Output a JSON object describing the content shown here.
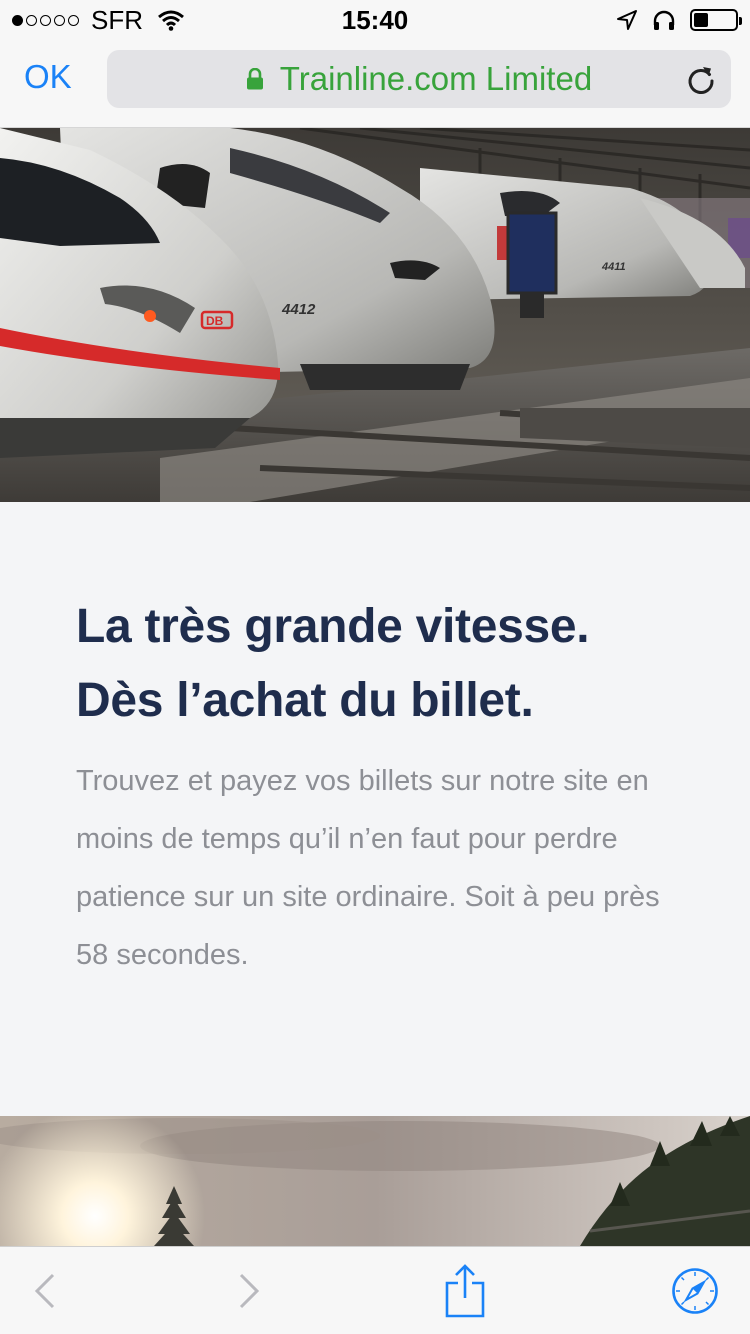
{
  "status_bar": {
    "carrier": "SFR",
    "time": "15:40",
    "signal_bars_filled": 1,
    "signal_bars_total": 5,
    "battery_level_fraction": 0.35,
    "icons": [
      "wifi-icon",
      "location-arrow-icon",
      "headphones-icon",
      "battery-icon"
    ]
  },
  "browser": {
    "done_label": "OK",
    "url_title": "Trainline.com Limited",
    "secure": true,
    "colors": {
      "accent": "#1a82f7",
      "secure_text": "#38a33b"
    }
  },
  "page": {
    "headline_line1": "La très grande vitesse.",
    "headline_line2": "Dès l’achat du billet.",
    "body": "Trouvez et payez vos billets sur notre site en moins de temps qu’il n’en faut pour perdre patience sur un site ordinaire. Soit à peu près 58 secondes.",
    "colors": {
      "headline": "#1f2d4d",
      "body": "#8d8f95"
    },
    "hero_train_labels": [
      "DB",
      "4412",
      "4411"
    ]
  },
  "toolbar": {
    "buttons": [
      "back-icon",
      "forward-icon",
      "share-icon",
      "compass-icon"
    ],
    "back_enabled": false,
    "forward_enabled": false
  }
}
